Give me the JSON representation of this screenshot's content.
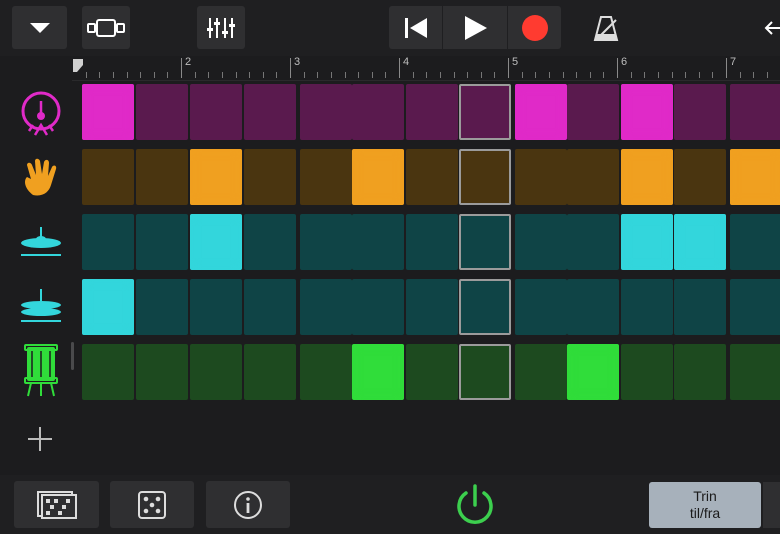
{
  "ruler": {
    "bars": [
      "2",
      "3",
      "4",
      "5",
      "6",
      "7"
    ]
  },
  "icons": {
    "menu": "chevron-down-icon",
    "loop": "loop-browser-icon",
    "mixer": "mixer-sliders-icon",
    "rewind": "rewind-icon",
    "play": "play-icon",
    "record": "record-icon",
    "metronome": "metronome-icon",
    "patterns": "pattern-grid-icon",
    "randomize": "dice-icon",
    "info": "info-icon",
    "power": "power-icon",
    "add": "plus-icon"
  },
  "colors": {
    "record": "#ff3b30",
    "power": "#3ccf4e",
    "step_toggle_bg": "#a7b1bb"
  },
  "tracks": [
    {
      "icon": "kick-drum-icon",
      "color": "#e02ac8",
      "dim": "#5a1a4e",
      "steps": [
        1,
        0,
        0,
        0,
        0,
        0,
        0,
        0,
        1,
        0,
        1,
        0,
        0
      ]
    },
    {
      "icon": "clap-hand-icon",
      "color": "#f0a020",
      "dim": "#4a3510",
      "steps": [
        0,
        0,
        1,
        0,
        0,
        1,
        0,
        0,
        0,
        0,
        1,
        0,
        1
      ]
    },
    {
      "icon": "cymbal-icon",
      "color": "#33d6dc",
      "dim": "#0f4446",
      "steps": [
        0,
        0,
        1,
        0,
        0,
        0,
        0,
        0,
        0,
        0,
        1,
        1,
        0
      ]
    },
    {
      "icon": "hihat-icon",
      "color": "#33d6dc",
      "dim": "#0f4446",
      "steps": [
        1,
        0,
        0,
        0,
        0,
        0,
        0,
        0,
        0,
        0,
        0,
        0,
        0
      ]
    },
    {
      "icon": "snare-drum-icon",
      "color": "#30dd3a",
      "dim": "#1d4a1f",
      "steps": [
        0,
        0,
        0,
        0,
        0,
        1,
        0,
        0,
        0,
        1,
        0,
        0,
        0
      ]
    }
  ],
  "grid": {
    "cursor_column": 7
  },
  "footer": {
    "step_toggle_line1": "Trin",
    "step_toggle_line2": "til/fra"
  }
}
